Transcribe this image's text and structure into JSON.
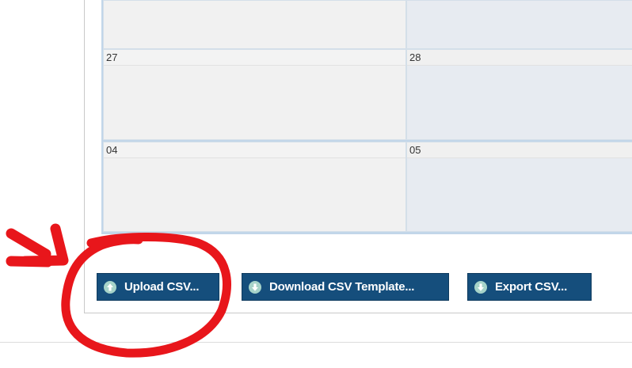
{
  "calendar": {
    "days": [
      {
        "label": "27"
      },
      {
        "label": "28"
      },
      {
        "label": "04"
      },
      {
        "label": "05"
      }
    ]
  },
  "actions": {
    "upload_label": "Upload CSV...",
    "download_template_label": "Download CSV Template...",
    "export_label": "Export CSV..."
  },
  "colors": {
    "button_bg": "#154e7c",
    "annotation_red": "#e8161b"
  },
  "icons": {
    "upload": "arrow-up-circle-icon",
    "download": "arrow-down-circle-icon",
    "export": "arrow-down-circle-icon"
  }
}
